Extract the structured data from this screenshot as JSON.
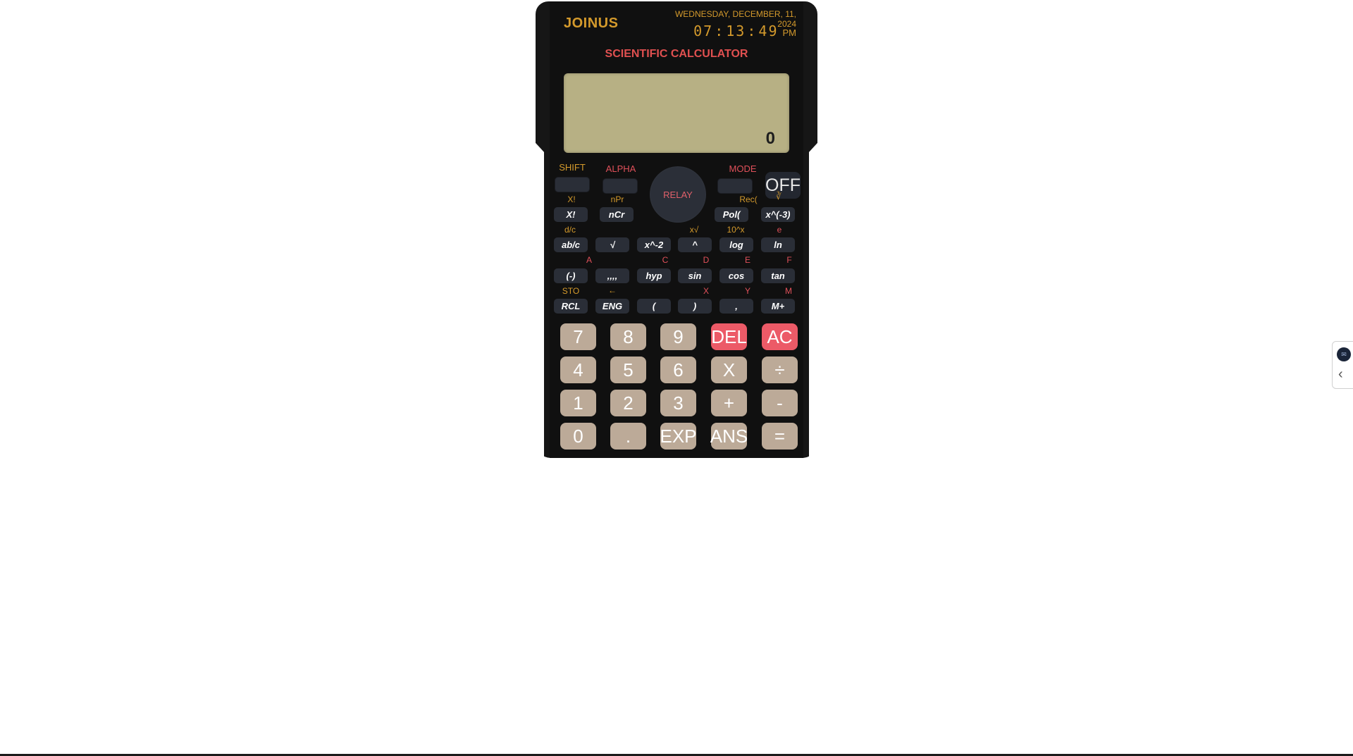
{
  "calculator": {
    "brand": "JOINUS",
    "date": "WEDNESDAY, DECEMBER, 11, 2024",
    "clock": {
      "hours": "07",
      "minutes": "13",
      "seconds": "49",
      "ampm": "PM",
      "sep": ":"
    },
    "model": "SCIENTIFIC CALCULATOR",
    "display_value": "0",
    "controls": {
      "shift": "SHIFT",
      "alpha": "ALPHA",
      "mode": "MODE",
      "relay": "RELAY",
      "off": "OFF"
    },
    "fn_rows": [
      {
        "labels": [
          "X!",
          "nPr",
          "",
          "Rec(",
          "∛"
        ],
        "keys": [
          "X!",
          "nCr",
          "",
          "Pol(",
          "x^(-3)"
        ]
      },
      {
        "labels": [
          "d/c",
          "",
          "",
          "x√",
          "10^x",
          "e"
        ],
        "keys": [
          "ab/c",
          "√",
          "x^-2",
          "^",
          "log",
          "ln"
        ]
      },
      {
        "labels": [
          "A",
          "",
          "C",
          "D",
          "E",
          "F"
        ],
        "keys": [
          "(-)",
          ",,,,",
          "hyp",
          "sin",
          "cos",
          "tan"
        ]
      },
      {
        "labels": [
          "STO",
          "←",
          "",
          "X",
          "Y",
          "M"
        ],
        "keys": [
          "RCL",
          "ENG",
          "(",
          ")",
          ",",
          "M+"
        ]
      }
    ],
    "keypad": [
      [
        "7",
        "8",
        "9",
        "DEL",
        "AC"
      ],
      [
        "4",
        "5",
        "6",
        "X",
        "÷"
      ],
      [
        "1",
        "2",
        "3",
        "+",
        "-"
      ],
      [
        "0",
        ".",
        "EXP",
        "ANS",
        "="
      ]
    ]
  },
  "colors": {
    "body": "#161616",
    "gold": "#d49a2c",
    "red_label": "#e0505a",
    "lcd": "#b7b084",
    "key": "#bcaa98",
    "key_red": "#ec5a67",
    "fn_key": "#2a2e37"
  },
  "side_widget": {
    "icon": "chat-icon",
    "toggle_icon": "chevron-left-icon"
  }
}
